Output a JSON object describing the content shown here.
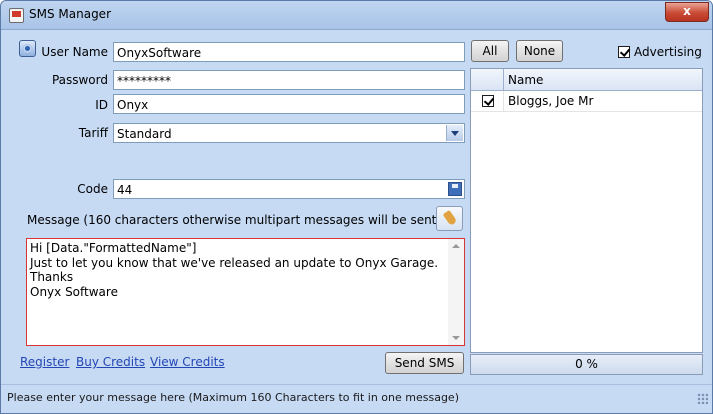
{
  "window": {
    "title": "SMS Manager",
    "close_label": "x"
  },
  "form": {
    "username_label": "User Name",
    "username_value": "OnyxSoftware",
    "password_label": "Password",
    "password_value": "*********",
    "id_label": "ID",
    "id_value": "Onyx",
    "tariff_label": "Tariff",
    "tariff_value": "Standard",
    "code_label": "Code",
    "code_value": "44",
    "message_label": "Message (160 characters otherwise multipart messages will be sent)",
    "message_lines": [
      "Hi [Data.\"FormattedName\"]",
      "Just to let you know that we've released an update to Onyx Garage.",
      "Thanks",
      "Onyx Software"
    ]
  },
  "links": {
    "register": "Register",
    "buy_credits": "Buy Credits",
    "view_credits": "View Credits"
  },
  "buttons": {
    "send_sms": "Send SMS",
    "all": "All",
    "none": "None"
  },
  "advertising": {
    "label": "Advertising",
    "checked": true
  },
  "recipients": {
    "header_name": "Name",
    "rows": [
      {
        "name": "Bloggs, Joe Mr",
        "checked": true
      }
    ]
  },
  "progress": {
    "text": "0 %",
    "value": 0
  },
  "status": {
    "text": "Please enter your message here (Maximum 160 Characters to fit in one message)"
  },
  "icons": {
    "help": "help-icon",
    "save": "save-icon",
    "clear": "brush-icon",
    "dropdown": "chevron-down-icon"
  }
}
